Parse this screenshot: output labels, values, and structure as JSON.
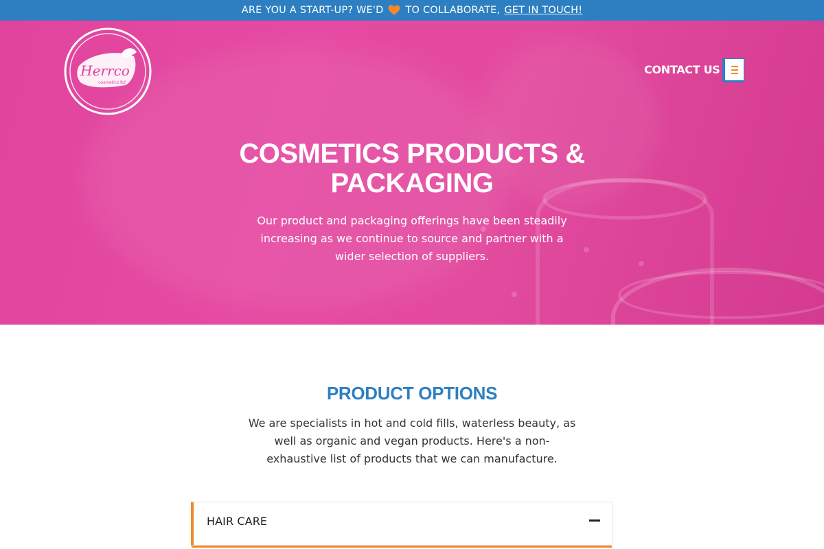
{
  "announcement": {
    "text_before": "ARE YOU A START-UP? WE'D",
    "heart_icon": "heart-icon",
    "heart_color": "#f0892b",
    "text_after": "TO COLLABORATE,",
    "link_label": "GET IN TOUCH!"
  },
  "header": {
    "logo_icon": "herrco-logo",
    "logo_text": "Herrco",
    "logo_subtext": "cosmetics ltd",
    "contact_label": "CONTACT US",
    "menu_icon": "hamburger-menu-icon"
  },
  "hero": {
    "title": "COSMETICS PRODUCTS & PACKAGING",
    "description": "Our product and packaging offerings have been steadily increasing as we continue to source and partner with a wider selection of suppliers."
  },
  "product_options": {
    "title": "PRODUCT OPTIONS",
    "description": "We are specialists in hot and cold fills, waterless beauty, as well as organic and vegan products. Here's a non-exhaustive list of products that we can manufacture.",
    "accordion": [
      {
        "label": "HAIR CARE",
        "expanded": true,
        "toggle_icon": "minus-icon"
      }
    ]
  },
  "colors": {
    "brand_blue": "#2d7fc1",
    "hero_pink": "#e0449d",
    "accent_orange": "#f0892b"
  }
}
